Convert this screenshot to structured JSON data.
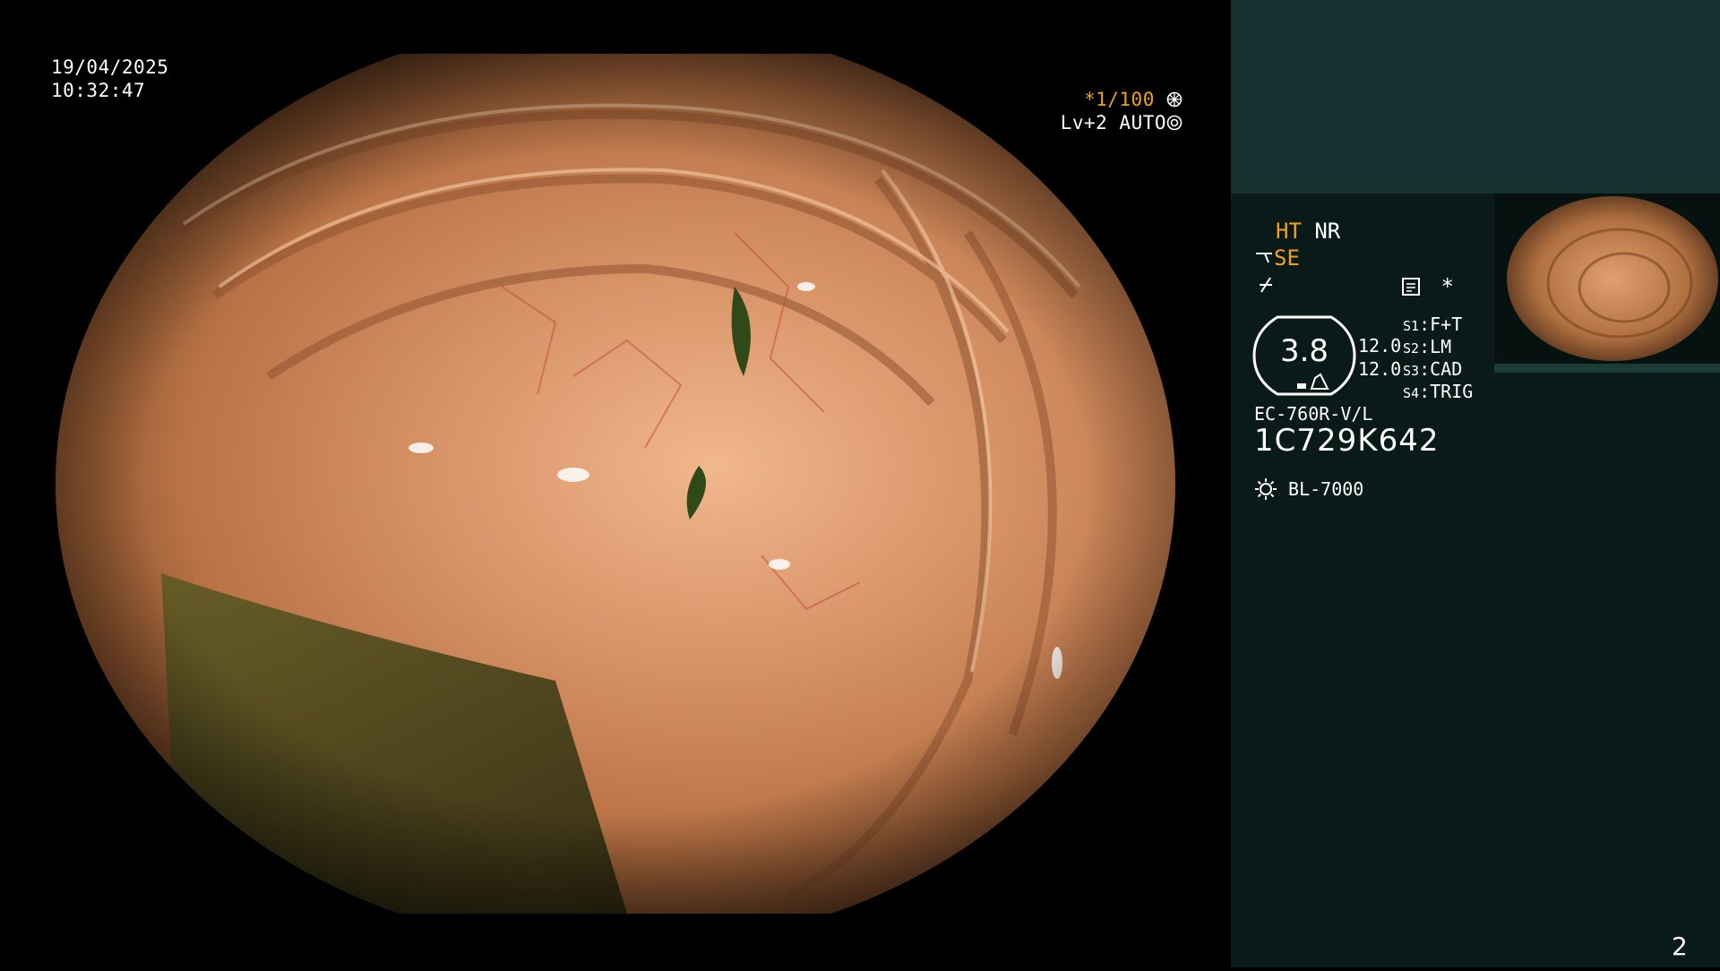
{
  "overlay": {
    "date": "19/04/2025",
    "time": "10:32:47",
    "shutter_prefix": "*",
    "shutter": "1/100",
    "level": "Lv+2",
    "iris": "AUTO"
  },
  "status": {
    "ht": "HT",
    "nr": "NR",
    "se": "SE",
    "asterisk": "*",
    "gauge_value": "3.8",
    "value_upper": "12.0",
    "value_lower": "12.0",
    "switches": [
      {
        "key": "S1",
        "value": "F+T"
      },
      {
        "key": "S2",
        "value": "LM"
      },
      {
        "key": "S3",
        "value": "CAD"
      },
      {
        "key": "S4",
        "value": "TRIG"
      }
    ],
    "scope_model": "EC-760R-V/L",
    "serial": "1C729K642",
    "light_source": "BL-7000"
  },
  "page_number": "2",
  "colors": {
    "accent": "#f0a020",
    "panel_top": "#15302e",
    "panel_main": "#0a1a18"
  },
  "icons": [
    "aperture-icon",
    "iris-icon",
    "water-jet-icon",
    "freeze-icon",
    "memo-icon",
    "gauge-icon",
    "light-source-icon"
  ]
}
